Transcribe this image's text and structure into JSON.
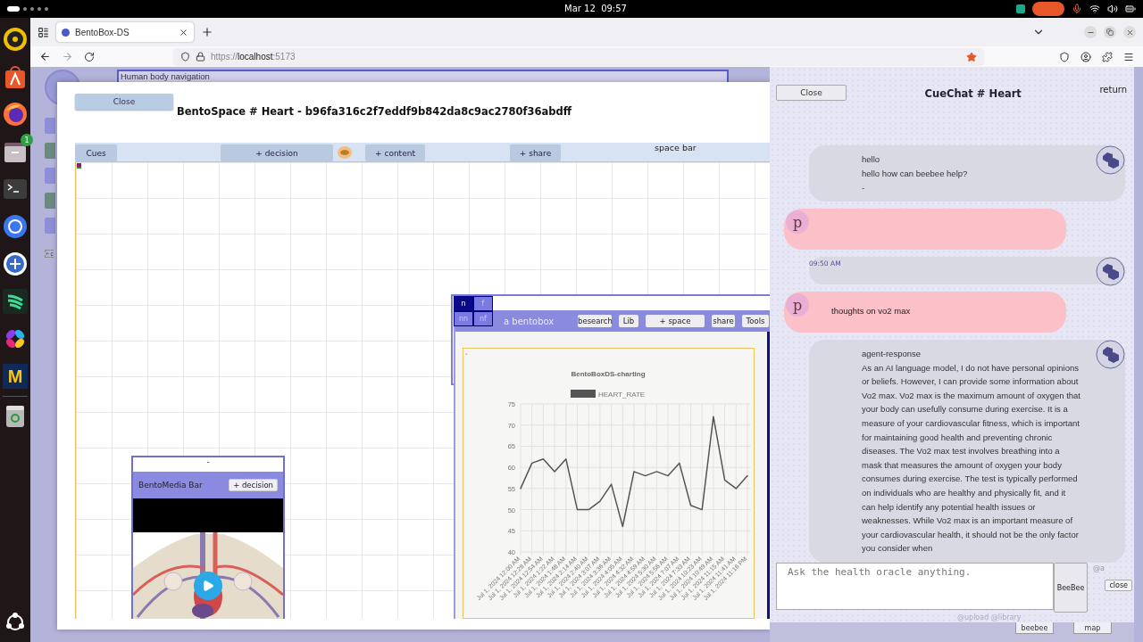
{
  "system_bar": {
    "date": "Mar 12",
    "time": "09:57"
  },
  "dock": [
    {
      "kind": "speaker"
    },
    {
      "kind": "store"
    },
    {
      "kind": "browser"
    },
    {
      "kind": "files",
      "badge": "1"
    },
    {
      "kind": "terminal"
    },
    {
      "kind": "chat"
    },
    {
      "kind": "code"
    },
    {
      "kind": "waves"
    },
    {
      "kind": "petals"
    },
    {
      "kind": "letter",
      "label": "M"
    },
    {
      "kind": "trash"
    }
  ],
  "browser": {
    "tab_title": "BentoBox-DS",
    "url": {
      "scheme": "https://",
      "host": "localhost",
      "port": ":5173"
    }
  },
  "background": {
    "navigation_label": "Human body navigation",
    "add_label": "+ c"
  },
  "bentospace": {
    "close": "Close",
    "title": "BentoSpace # Heart - b96fa316c2f7eddf9b842da8c9ac2780f36abdff",
    "toolbar": [
      {
        "kind": "button",
        "label": "Cues"
      },
      {
        "kind": "button",
        "label": "+ decision"
      },
      {
        "kind": "icon"
      },
      {
        "kind": "button",
        "label": "+ content"
      },
      {
        "kind": "button",
        "label": "+ share"
      },
      {
        "kind": "text",
        "label": "space bar"
      }
    ],
    "media_bar": {
      "header": "-",
      "title": "BentoMedia Bar",
      "button": "+ decision"
    },
    "bentobox": {
      "tabs": [
        {
          "label": "n",
          "selected": true
        },
        {
          "label": "f",
          "selected": false
        },
        {
          "label": "nn",
          "selected": false
        },
        {
          "label": "nf",
          "selected": false
        }
      ],
      "title": "a bentobox",
      "buttons": [
        "besearch",
        "Lib",
        "+ space",
        "share",
        "Tools"
      ],
      "marker": "-",
      "chart_data": {
        "type": "line",
        "title": "BentoBoxDS-charting",
        "grid": true,
        "ylim": [
          40,
          75
        ],
        "yticks": [
          40,
          45,
          50,
          55,
          60,
          65,
          70,
          75
        ],
        "categories": [
          "Jul 1, 2024 12:00 AM",
          "Jul 1, 2024 12:28 AM",
          "Jul 1, 2024 12:54 AM",
          "Jul 1, 2024 1:22 AM",
          "Jul 1, 2024 1:48 AM",
          "Jul 1, 2024 2:14 AM",
          "Jul 1, 2024 2:40 AM",
          "Jul 1, 2024 3:07 AM",
          "Jul 1, 2024 3:36 AM",
          "Jul 1, 2024 4:05 AM",
          "Jul 1, 2024 4:32 AM",
          "Jul 1, 2024 4:59 AM",
          "Jul 1, 2024 5:30 AM",
          "Jul 1, 2024 5:56 AM",
          "Jul 1, 2024 7:07 AM",
          "Jul 1, 2024 7:33 AM",
          "Jul 1, 2024 10:23 AM",
          "Jul 1, 2024 10:49 AM",
          "Jul 1, 2024 11:15 AM",
          "Jul 1, 2024 11:41 AM",
          "Jul 1, 2024 11:16 PM"
        ],
        "series": [
          {
            "name": "HEART_RATE",
            "color": "#555555",
            "values": [
              55,
              61,
              62,
              59,
              62,
              50,
              50,
              52,
              56,
              46,
              59,
              58,
              59,
              58,
              61,
              51,
              50,
              72,
              57,
              55,
              58
            ]
          }
        ]
      }
    }
  },
  "cuechat": {
    "close": "Close",
    "title": "CueChat # Heart",
    "return": "return",
    "messages": [
      {
        "kind": "bot",
        "lines": [
          "hello",
          "hello how can beebee help?",
          "-"
        ]
      },
      {
        "kind": "user",
        "avatar": "p"
      },
      {
        "kind": "bot",
        "time": "09:50 AM"
      },
      {
        "kind": "user",
        "avatar": "p",
        "text": "thoughts on vo2 max"
      },
      {
        "kind": "bot",
        "lines": [
          "agent-response",
          "As an AI language model, I do not have personal opinions or beliefs. However, I can provide some information about Vo2 max. Vo2 max is the maximum amount of oxygen that your body can usefully consume during exercise. It is a measure of your cardiovascular fitness, which is important for maintaining good health and preventing chronic diseases. The Vo2 max test involves breathing into a mask that measures the amount of oxygen your body consumes during exercise. The test is typically performed on individuals who are healthy and physically fit, and it can help identify any potential health issues or weaknesses. While Vo2 max is an important measure of your cardiovascular health, it should not be the only factor you consider when"
        ]
      }
    ],
    "input_placeholder": "Ask the health oracle anything.",
    "send": "BeeBee",
    "mention": "@a",
    "close_small": "close",
    "links": "@upload  @library",
    "bottom_buttons": [
      "beebee",
      "map"
    ]
  }
}
